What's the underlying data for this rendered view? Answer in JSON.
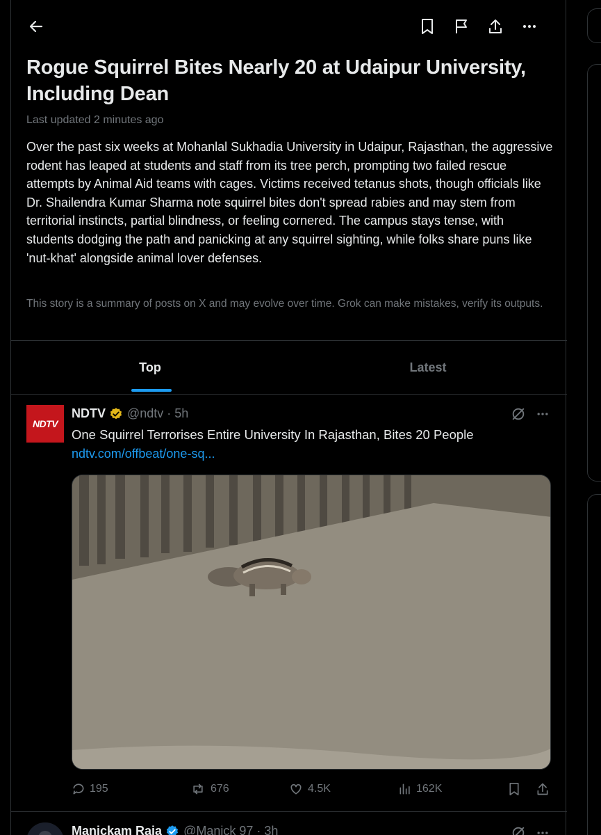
{
  "article": {
    "title": "Rogue Squirrel Bites Nearly 20 at Udaipur University, Including Dean",
    "updated": "Last updated 2 minutes ago",
    "summary": "Over the past six weeks at Mohanlal Sukhadia University in Udaipur, Rajasthan, the aggressive rodent has leaped at students and staff from its tree perch, prompting two failed rescue attempts by Animal Aid teams with cages. Victims received tetanus shots, though officials like Dr. Shailendra Kumar Sharma note squirrel bites don't spread rabies and may stem from territorial instincts, partial blindness, or feeling cornered. The campus stays tense, with students dodging the path and panicking at any squirrel sighting, while folks share puns like 'nut-khat' alongside animal lover defenses.",
    "disclaimer": "This story is a summary of posts on X and may evolve over time. Grok can make mistakes, verify its outputs."
  },
  "tabs": [
    {
      "label": "Top",
      "active": true
    },
    {
      "label": "Latest",
      "active": false
    }
  ],
  "tweets": [
    {
      "avatar_text": "NDTV",
      "name": "NDTV",
      "handle": "@ndtv · 5h",
      "text": "One Squirrel Terrorises Entire University In Rajasthan, Bites 20 People",
      "link": "ndtv.com/offbeat/one-sq...",
      "replies": "195",
      "reposts": "676",
      "likes": "4.5K",
      "views": "162K"
    },
    {
      "name": "Manickam Raja",
      "handle": "@Manick 97 · 3h"
    }
  ],
  "icons": {
    "back": "arrow-left-icon",
    "bookmark": "bookmark-icon",
    "flag": "flag-icon",
    "share": "share-icon",
    "more": "more-icon",
    "verified": "verified-badge-icon",
    "grok": "grok-icon"
  },
  "colors": {
    "background": "#000000",
    "accent": "#1d9bf0",
    "muted": "#71767b",
    "ndtv_red": "#c4161c",
    "gold_badge": "#e2b719"
  }
}
